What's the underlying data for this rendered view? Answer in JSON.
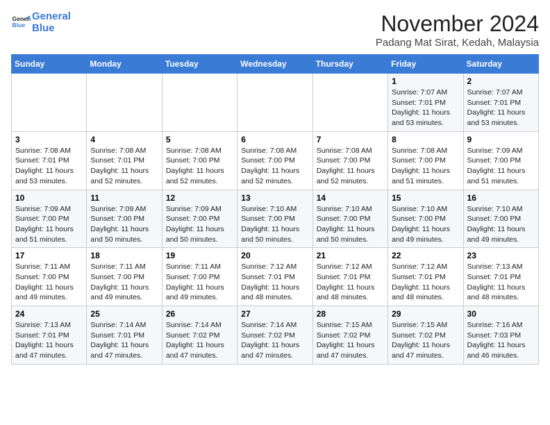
{
  "header": {
    "logo_line1": "General",
    "logo_line2": "Blue",
    "month": "November 2024",
    "location": "Padang Mat Sirat, Kedah, Malaysia"
  },
  "weekdays": [
    "Sunday",
    "Monday",
    "Tuesday",
    "Wednesday",
    "Thursday",
    "Friday",
    "Saturday"
  ],
  "weeks": [
    [
      {
        "day": "",
        "info": ""
      },
      {
        "day": "",
        "info": ""
      },
      {
        "day": "",
        "info": ""
      },
      {
        "day": "",
        "info": ""
      },
      {
        "day": "",
        "info": ""
      },
      {
        "day": "1",
        "info": "Sunrise: 7:07 AM\nSunset: 7:01 PM\nDaylight: 11 hours\nand 53 minutes."
      },
      {
        "day": "2",
        "info": "Sunrise: 7:07 AM\nSunset: 7:01 PM\nDaylight: 11 hours\nand 53 minutes."
      }
    ],
    [
      {
        "day": "3",
        "info": "Sunrise: 7:08 AM\nSunset: 7:01 PM\nDaylight: 11 hours\nand 53 minutes."
      },
      {
        "day": "4",
        "info": "Sunrise: 7:08 AM\nSunset: 7:01 PM\nDaylight: 11 hours\nand 52 minutes."
      },
      {
        "day": "5",
        "info": "Sunrise: 7:08 AM\nSunset: 7:00 PM\nDaylight: 11 hours\nand 52 minutes."
      },
      {
        "day": "6",
        "info": "Sunrise: 7:08 AM\nSunset: 7:00 PM\nDaylight: 11 hours\nand 52 minutes."
      },
      {
        "day": "7",
        "info": "Sunrise: 7:08 AM\nSunset: 7:00 PM\nDaylight: 11 hours\nand 52 minutes."
      },
      {
        "day": "8",
        "info": "Sunrise: 7:08 AM\nSunset: 7:00 PM\nDaylight: 11 hours\nand 51 minutes."
      },
      {
        "day": "9",
        "info": "Sunrise: 7:09 AM\nSunset: 7:00 PM\nDaylight: 11 hours\nand 51 minutes."
      }
    ],
    [
      {
        "day": "10",
        "info": "Sunrise: 7:09 AM\nSunset: 7:00 PM\nDaylight: 11 hours\nand 51 minutes."
      },
      {
        "day": "11",
        "info": "Sunrise: 7:09 AM\nSunset: 7:00 PM\nDaylight: 11 hours\nand 50 minutes."
      },
      {
        "day": "12",
        "info": "Sunrise: 7:09 AM\nSunset: 7:00 PM\nDaylight: 11 hours\nand 50 minutes."
      },
      {
        "day": "13",
        "info": "Sunrise: 7:10 AM\nSunset: 7:00 PM\nDaylight: 11 hours\nand 50 minutes."
      },
      {
        "day": "14",
        "info": "Sunrise: 7:10 AM\nSunset: 7:00 PM\nDaylight: 11 hours\nand 50 minutes."
      },
      {
        "day": "15",
        "info": "Sunrise: 7:10 AM\nSunset: 7:00 PM\nDaylight: 11 hours\nand 49 minutes."
      },
      {
        "day": "16",
        "info": "Sunrise: 7:10 AM\nSunset: 7:00 PM\nDaylight: 11 hours\nand 49 minutes."
      }
    ],
    [
      {
        "day": "17",
        "info": "Sunrise: 7:11 AM\nSunset: 7:00 PM\nDaylight: 11 hours\nand 49 minutes."
      },
      {
        "day": "18",
        "info": "Sunrise: 7:11 AM\nSunset: 7:00 PM\nDaylight: 11 hours\nand 49 minutes."
      },
      {
        "day": "19",
        "info": "Sunrise: 7:11 AM\nSunset: 7:00 PM\nDaylight: 11 hours\nand 49 minutes."
      },
      {
        "day": "20",
        "info": "Sunrise: 7:12 AM\nSunset: 7:01 PM\nDaylight: 11 hours\nand 48 minutes."
      },
      {
        "day": "21",
        "info": "Sunrise: 7:12 AM\nSunset: 7:01 PM\nDaylight: 11 hours\nand 48 minutes."
      },
      {
        "day": "22",
        "info": "Sunrise: 7:12 AM\nSunset: 7:01 PM\nDaylight: 11 hours\nand 48 minutes."
      },
      {
        "day": "23",
        "info": "Sunrise: 7:13 AM\nSunset: 7:01 PM\nDaylight: 11 hours\nand 48 minutes."
      }
    ],
    [
      {
        "day": "24",
        "info": "Sunrise: 7:13 AM\nSunset: 7:01 PM\nDaylight: 11 hours\nand 47 minutes."
      },
      {
        "day": "25",
        "info": "Sunrise: 7:14 AM\nSunset: 7:01 PM\nDaylight: 11 hours\nand 47 minutes."
      },
      {
        "day": "26",
        "info": "Sunrise: 7:14 AM\nSunset: 7:02 PM\nDaylight: 11 hours\nand 47 minutes."
      },
      {
        "day": "27",
        "info": "Sunrise: 7:14 AM\nSunset: 7:02 PM\nDaylight: 11 hours\nand 47 minutes."
      },
      {
        "day": "28",
        "info": "Sunrise: 7:15 AM\nSunset: 7:02 PM\nDaylight: 11 hours\nand 47 minutes."
      },
      {
        "day": "29",
        "info": "Sunrise: 7:15 AM\nSunset: 7:02 PM\nDaylight: 11 hours\nand 47 minutes."
      },
      {
        "day": "30",
        "info": "Sunrise: 7:16 AM\nSunset: 7:03 PM\nDaylight: 11 hours\nand 46 minutes."
      }
    ]
  ]
}
